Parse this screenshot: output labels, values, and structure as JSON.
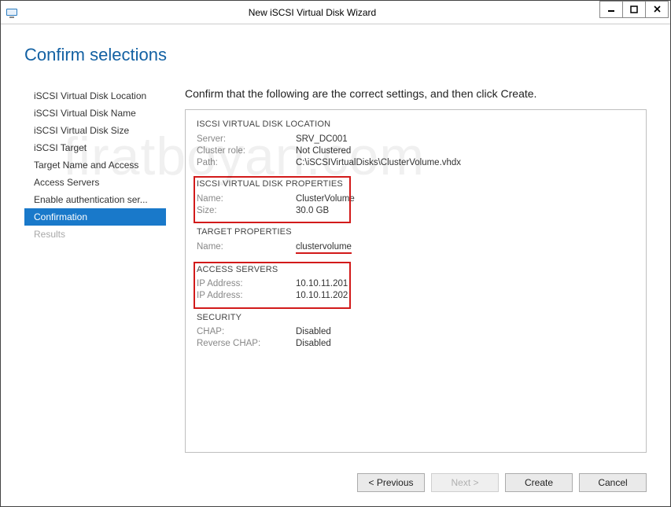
{
  "title": "New iSCSI Virtual Disk Wizard",
  "page_heading": "Confirm selections",
  "instruction": "Confirm that the following are the correct settings, and then click Create.",
  "watermark": "firatboyan.com",
  "sidebar": {
    "items": [
      {
        "label": "iSCSI Virtual Disk Location"
      },
      {
        "label": "iSCSI Virtual Disk Name"
      },
      {
        "label": "iSCSI Virtual Disk Size"
      },
      {
        "label": "iSCSI Target"
      },
      {
        "label": "Target Name and Access"
      },
      {
        "label": "Access Servers"
      },
      {
        "label": "Enable authentication ser..."
      },
      {
        "label": "Confirmation"
      },
      {
        "label": "Results"
      }
    ]
  },
  "sections": {
    "location": {
      "header": "ISCSI VIRTUAL DISK LOCATION",
      "server_label": "Server:",
      "server_value": "SRV_DC001",
      "cluster_label": "Cluster role:",
      "cluster_value": "Not Clustered",
      "path_label": "Path:",
      "path_value": "C:\\iSCSIVirtualDisks\\ClusterVolume.vhdx"
    },
    "properties": {
      "header": "ISCSI VIRTUAL DISK PROPERTIES",
      "name_label": "Name:",
      "name_value": "ClusterVolume",
      "size_label": "Size:",
      "size_value": "30.0 GB"
    },
    "target": {
      "header": "TARGET PROPERTIES",
      "name_label": "Name:",
      "name_value": "clustervolume"
    },
    "access": {
      "header": "ACCESS SERVERS",
      "ip1_label": "IP Address:",
      "ip1_value": "10.10.11.201",
      "ip2_label": "IP Address:",
      "ip2_value": "10.10.11.202"
    },
    "security": {
      "header": "SECURITY",
      "chap_label": "CHAP:",
      "chap_value": "Disabled",
      "rchap_label": "Reverse CHAP:",
      "rchap_value": "Disabled"
    }
  },
  "buttons": {
    "previous": "< Previous",
    "next": "Next >",
    "create": "Create",
    "cancel": "Cancel"
  }
}
